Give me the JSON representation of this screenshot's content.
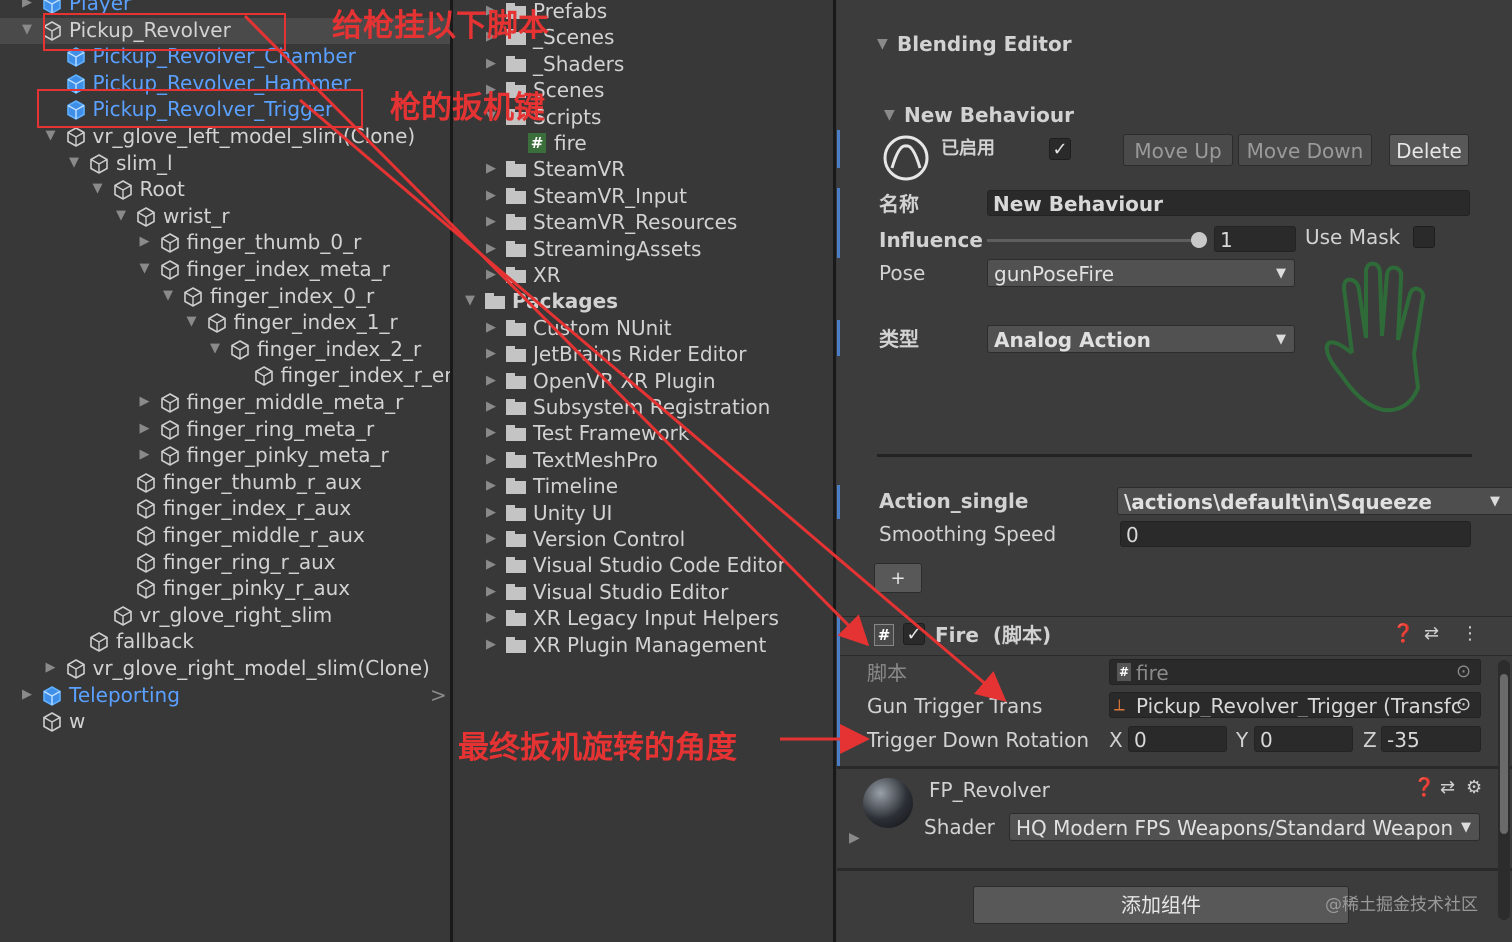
{
  "hierarchy": {
    "items": [
      {
        "label": "Player",
        "depth": 0,
        "arrow": "right",
        "blue": true,
        "icon": "prefab-cube-icon"
      },
      {
        "label": "Pickup_Revolver",
        "depth": 0,
        "arrow": "down",
        "blue": false,
        "icon": "prefab-cube-icon",
        "selected": true
      },
      {
        "label": "Pickup_Revolver_Chamber",
        "depth": 1,
        "arrow": "",
        "blue": true,
        "icon": "cube-icon"
      },
      {
        "label": "Pickup_Revolver_Hammer",
        "depth": 1,
        "arrow": "",
        "blue": true,
        "icon": "cube-icon"
      },
      {
        "label": "Pickup_Revolver_Trigger",
        "depth": 1,
        "arrow": "",
        "blue": true,
        "icon": "cube-icon"
      },
      {
        "label": "vr_glove_left_model_slim(Clone)",
        "depth": 1,
        "arrow": "down",
        "blue": false,
        "icon": "cube-icon"
      },
      {
        "label": "slim_l",
        "depth": 2,
        "arrow": "down",
        "blue": false,
        "icon": "cube-icon"
      },
      {
        "label": "Root",
        "depth": 3,
        "arrow": "down",
        "blue": false,
        "icon": "cube-icon"
      },
      {
        "label": "wrist_r",
        "depth": 4,
        "arrow": "down",
        "blue": false,
        "icon": "cube-icon"
      },
      {
        "label": "finger_thumb_0_r",
        "depth": 5,
        "arrow": "right",
        "blue": false,
        "icon": "cube-icon"
      },
      {
        "label": "finger_index_meta_r",
        "depth": 5,
        "arrow": "down",
        "blue": false,
        "icon": "cube-icon"
      },
      {
        "label": "finger_index_0_r",
        "depth": 6,
        "arrow": "down",
        "blue": false,
        "icon": "cube-icon"
      },
      {
        "label": "finger_index_1_r",
        "depth": 7,
        "arrow": "down",
        "blue": false,
        "icon": "cube-icon"
      },
      {
        "label": "finger_index_2_r",
        "depth": 8,
        "arrow": "down",
        "blue": false,
        "icon": "cube-icon"
      },
      {
        "label": "finger_index_r_end",
        "depth": 9,
        "arrow": "",
        "blue": false,
        "icon": "cube-icon"
      },
      {
        "label": "finger_middle_meta_r",
        "depth": 5,
        "arrow": "right",
        "blue": false,
        "icon": "cube-icon"
      },
      {
        "label": "finger_ring_meta_r",
        "depth": 5,
        "arrow": "right",
        "blue": false,
        "icon": "cube-icon"
      },
      {
        "label": "finger_pinky_meta_r",
        "depth": 5,
        "arrow": "right",
        "blue": false,
        "icon": "cube-icon"
      },
      {
        "label": "finger_thumb_r_aux",
        "depth": 4,
        "arrow": "",
        "blue": false,
        "icon": "cube-icon"
      },
      {
        "label": "finger_index_r_aux",
        "depth": 4,
        "arrow": "",
        "blue": false,
        "icon": "cube-icon"
      },
      {
        "label": "finger_middle_r_aux",
        "depth": 4,
        "arrow": "",
        "blue": false,
        "icon": "cube-icon"
      },
      {
        "label": "finger_ring_r_aux",
        "depth": 4,
        "arrow": "",
        "blue": false,
        "icon": "cube-icon"
      },
      {
        "label": "finger_pinky_r_aux",
        "depth": 4,
        "arrow": "",
        "blue": false,
        "icon": "cube-icon"
      },
      {
        "label": "vr_glove_right_slim",
        "depth": 3,
        "arrow": "",
        "blue": false,
        "icon": "cube-icon"
      },
      {
        "label": "fallback",
        "depth": 2,
        "arrow": "",
        "blue": false,
        "icon": "cube-icon"
      },
      {
        "label": "vr_glove_right_model_slim(Clone)",
        "depth": 1,
        "arrow": "right",
        "blue": false,
        "icon": "cube-icon"
      },
      {
        "label": "Teleporting",
        "depth": 0,
        "arrow": "right",
        "blue": true,
        "icon": "prefab-cube-icon",
        "chevron": ">"
      },
      {
        "label": "w",
        "depth": 0,
        "arrow": "",
        "blue": false,
        "icon": "cube-icon"
      }
    ]
  },
  "project": {
    "items": [
      {
        "label": "Prefabs",
        "depth": 1,
        "arrow": "right",
        "type": "folder"
      },
      {
        "label": "_Scenes",
        "depth": 1,
        "arrow": "right",
        "type": "folder"
      },
      {
        "label": "_Shaders",
        "depth": 1,
        "arrow": "right",
        "type": "folder"
      },
      {
        "label": "Scenes",
        "depth": 1,
        "arrow": "right",
        "type": "folder"
      },
      {
        "label": "Scripts",
        "depth": 1,
        "arrow": "down",
        "type": "folder"
      },
      {
        "label": "fire",
        "depth": 2,
        "arrow": "",
        "type": "script"
      },
      {
        "label": "SteamVR",
        "depth": 1,
        "arrow": "right",
        "type": "folder"
      },
      {
        "label": "SteamVR_Input",
        "depth": 1,
        "arrow": "right",
        "type": "folder"
      },
      {
        "label": "SteamVR_Resources",
        "depth": 1,
        "arrow": "right",
        "type": "folder"
      },
      {
        "label": "StreamingAssets",
        "depth": 1,
        "arrow": "right",
        "type": "folder"
      },
      {
        "label": "XR",
        "depth": 1,
        "arrow": "right",
        "type": "folder"
      },
      {
        "label": "Packages",
        "depth": 0,
        "arrow": "down",
        "type": "folder",
        "bold": true
      },
      {
        "label": "Custom NUnit",
        "depth": 1,
        "arrow": "right",
        "type": "folder"
      },
      {
        "label": "JetBrains Rider Editor",
        "depth": 1,
        "arrow": "right",
        "type": "folder"
      },
      {
        "label": "OpenVR XR Plugin",
        "depth": 1,
        "arrow": "right",
        "type": "folder"
      },
      {
        "label": "Subsystem Registration",
        "depth": 1,
        "arrow": "right",
        "type": "folder"
      },
      {
        "label": "Test Framework",
        "depth": 1,
        "arrow": "right",
        "type": "folder"
      },
      {
        "label": "TextMeshPro",
        "depth": 1,
        "arrow": "right",
        "type": "folder"
      },
      {
        "label": "Timeline",
        "depth": 1,
        "arrow": "right",
        "type": "folder"
      },
      {
        "label": "Unity UI",
        "depth": 1,
        "arrow": "right",
        "type": "folder"
      },
      {
        "label": "Version Control",
        "depth": 1,
        "arrow": "right",
        "type": "folder"
      },
      {
        "label": "Visual Studio Code Editor",
        "depth": 1,
        "arrow": "right",
        "type": "folder"
      },
      {
        "label": "Visual Studio Editor",
        "depth": 1,
        "arrow": "right",
        "type": "folder"
      },
      {
        "label": "XR Legacy Input Helpers",
        "depth": 1,
        "arrow": "right",
        "type": "folder"
      },
      {
        "label": "XR Plugin Management",
        "depth": 1,
        "arrow": "right",
        "type": "folder"
      }
    ]
  },
  "inspector": {
    "blending_title": "Blending Editor",
    "behaviour_title": "New Behaviour",
    "enabled_label": "已启用",
    "move_up": "Move Up",
    "move_down": "Move Down",
    "delete": "Delete",
    "name_label": "名称",
    "name_value": "New Behaviour",
    "influence_label": "Influence",
    "influence_value": "1",
    "influence_fraction": 1.0,
    "use_mask_label": "Use Mask",
    "pose_label": "Pose",
    "pose_value": "gunPoseFire",
    "type_label": "类型",
    "type_value": "Analog Action",
    "action_label": "Action_single",
    "action_value": "\\actions\\default\\in\\Squeeze",
    "smoothing_label": "Smoothing Speed",
    "smoothing_value": "0",
    "plus_button": "+",
    "fire_title": "Fire  (脚本)",
    "script_label": "脚本",
    "script_value": "fire",
    "gun_trigger_label": "Gun Trigger Trans",
    "gun_trigger_value": "Pickup_Revolver_Trigger (Transfc",
    "rotation_label": "Trigger Down Rotation",
    "x_label": "X",
    "x_value": "0",
    "y_label": "Y",
    "y_value": "0",
    "z_label": "Z",
    "z_value": "-35",
    "material_title": "FP_Revolver",
    "shader_label": "Shader",
    "shader_value": "HQ Modern FPS Weapons/Standard Weapon",
    "add_component": "添加组件",
    "watermark": "@稀土掘金技术社区",
    "colors": {
      "hand_green": "#2f6b39",
      "accent_blue": "#4a7fc8",
      "annotation_red": "#e53333"
    }
  },
  "annotations": {
    "attach_script": "给枪挂以下脚本",
    "trigger_key": "枪的扳机键",
    "final_angle": "最终扳机旋转的角度"
  }
}
